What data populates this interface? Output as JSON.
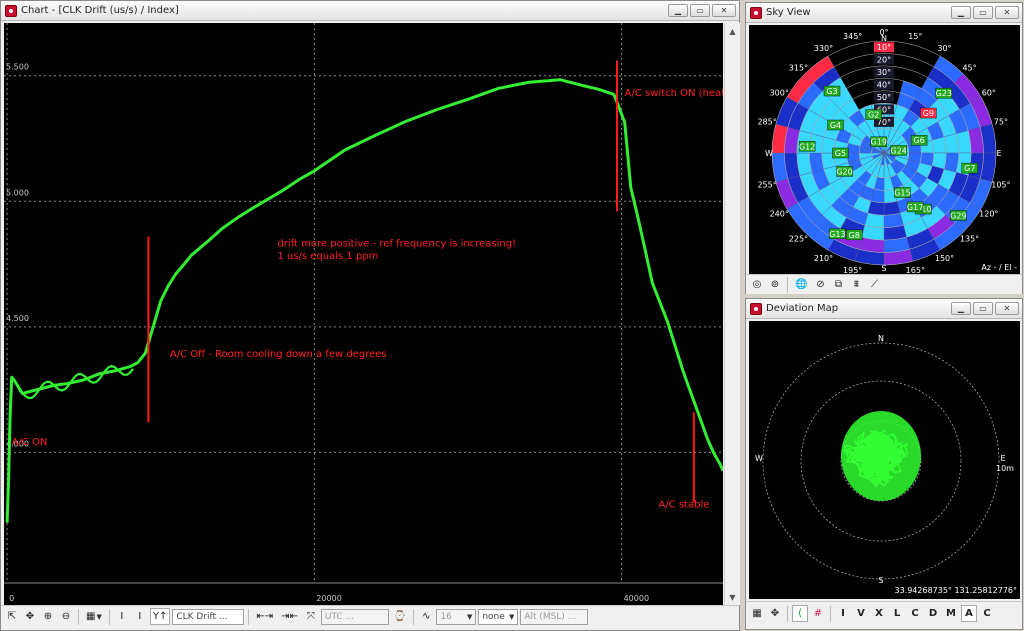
{
  "chart_window": {
    "title": "Chart - [CLK Drift (us/s) / Index]",
    "toolbar": {
      "series_select": "CLK Drift ...",
      "time_select": "UTC ...",
      "size_select": "16",
      "line_select": "none",
      "alt_select": "Alt (MSL) ..."
    }
  },
  "chart_data": {
    "type": "line",
    "title": "",
    "xlabel": "",
    "ylabel": "",
    "xlim": [
      -200,
      46600
    ],
    "ylim": [
      3.48,
      5.71
    ],
    "x_ticks": [
      "0",
      "20000",
      "40000"
    ],
    "y_ticks": [
      "4.000",
      "4.500",
      "5.000",
      "5.500"
    ],
    "x_tick_values": [
      0,
      20000,
      40000
    ],
    "y_tick_values": [
      4.0,
      4.5,
      5.0,
      5.5
    ],
    "grid": true,
    "series": [
      {
        "color": "#33ee33",
        "x": [
          0,
          100,
          200,
          300,
          500,
          1000,
          2000,
          3000,
          4000,
          5000,
          6000,
          7000,
          8000,
          8500,
          9000,
          9500,
          10000,
          10500,
          11000,
          11500,
          12000,
          13000,
          14000,
          15000,
          16000,
          17000,
          18000,
          19000,
          20000,
          22000,
          24000,
          26000,
          28000,
          30000,
          32000,
          34000,
          36000,
          37500,
          38500,
          39500,
          39800,
          40200,
          40600,
          41000,
          41500,
          42000,
          43000,
          44000,
          45000,
          45600,
          46000,
          46400,
          46600
        ],
        "y": [
          3.72,
          3.9,
          4.15,
          4.3,
          4.28,
          4.23,
          4.25,
          4.27,
          4.28,
          4.29,
          4.31,
          4.32,
          4.34,
          4.36,
          4.4,
          4.5,
          4.6,
          4.66,
          4.71,
          4.75,
          4.79,
          4.84,
          4.89,
          4.93,
          4.97,
          5.01,
          5.05,
          5.09,
          5.12,
          5.2,
          5.26,
          5.32,
          5.37,
          5.41,
          5.45,
          5.47,
          5.48,
          5.46,
          5.45,
          5.43,
          5.38,
          5.31,
          5.05,
          4.95,
          4.82,
          4.68,
          4.52,
          4.32,
          4.15,
          4.05,
          4.0,
          3.96,
          3.93
        ]
      }
    ],
    "annotations": [
      {
        "text": "A/C ON",
        "x": 300,
        "y": 4.03
      },
      {
        "text": "A/C Off - Room cooling down a few degrees",
        "x": 10600,
        "y": 4.38
      },
      {
        "text": "drift more positive - ref frequency is increasing!",
        "x": 17600,
        "y": 4.82
      },
      {
        "text": "1 us/s equals 1 ppm",
        "x": 17600,
        "y": 4.77
      },
      {
        "text": "A/C switch ON (heating)",
        "x": 40200,
        "y": 5.42
      },
      {
        "text": "A/C stable",
        "x": 42400,
        "y": 3.78
      }
    ],
    "markers": [
      {
        "x": 9200,
        "y1": 4.12,
        "y2": 4.86
      },
      {
        "x": 39700,
        "y1": 4.96,
        "y2": 5.56
      },
      {
        "x": 44700,
        "y1": 3.8,
        "y2": 4.16
      }
    ]
  },
  "sky_view": {
    "title": "Sky View",
    "footer": "Az - / El -",
    "directions": [
      "N",
      "E",
      "S",
      "W"
    ],
    "azimuth_labels": [
      "0°",
      "15°",
      "30°",
      "45°",
      "60°",
      "75°",
      "105°",
      "120°",
      "135°",
      "150°",
      "165°",
      "195°",
      "210°",
      "225°",
      "240°",
      "255°",
      "285°",
      "300°",
      "315°",
      "330°",
      "345°"
    ],
    "elevation_labels": [
      "10°",
      "20°",
      "30°",
      "40°",
      "50°",
      "60°",
      "70°"
    ],
    "satellites": [
      {
        "id": "G2",
        "az": 345,
        "el": 58
      },
      {
        "id": "G3",
        "az": 320,
        "el": 25
      },
      {
        "id": "G4",
        "az": 300,
        "el": 45
      },
      {
        "id": "G5",
        "az": 270,
        "el": 55
      },
      {
        "id": "G6",
        "az": 70,
        "el": 60
      },
      {
        "id": "G7",
        "az": 100,
        "el": 20
      },
      {
        "id": "G8",
        "az": 200,
        "el": 20
      },
      {
        "id": "G9",
        "az": 48,
        "el": 42
      },
      {
        "id": "G10",
        "az": 145,
        "el": 35
      },
      {
        "id": "G12",
        "az": 275,
        "el": 28
      },
      {
        "id": "G13",
        "az": 210,
        "el": 15
      },
      {
        "id": "G15",
        "az": 155,
        "el": 55
      },
      {
        "id": "G17",
        "az": 150,
        "el": 40
      },
      {
        "id": "G19",
        "az": 335,
        "el": 80
      },
      {
        "id": "G20",
        "az": 245,
        "el": 55
      },
      {
        "id": "G23",
        "az": 45,
        "el": 22
      },
      {
        "id": "G24",
        "az": 80,
        "el": 78
      },
      {
        "id": "G29",
        "az": 130,
        "el": 12
      }
    ],
    "colors": {
      "strong": "#38d8ff",
      "mid": "#2b6bff",
      "weak": "#1a2fc8",
      "violet": "#8a2be2",
      "bad": "#ff2a44"
    }
  },
  "deviation_map": {
    "title": "Deviation Map",
    "compass": [
      "N",
      "E",
      "S",
      "W"
    ],
    "ring_label": "10m",
    "coordinates": "33.94268735° 131.25812776°",
    "toolbar_letters": [
      "I",
      "V",
      "X",
      "L",
      "C",
      "D",
      "M",
      "A",
      "C"
    ]
  }
}
